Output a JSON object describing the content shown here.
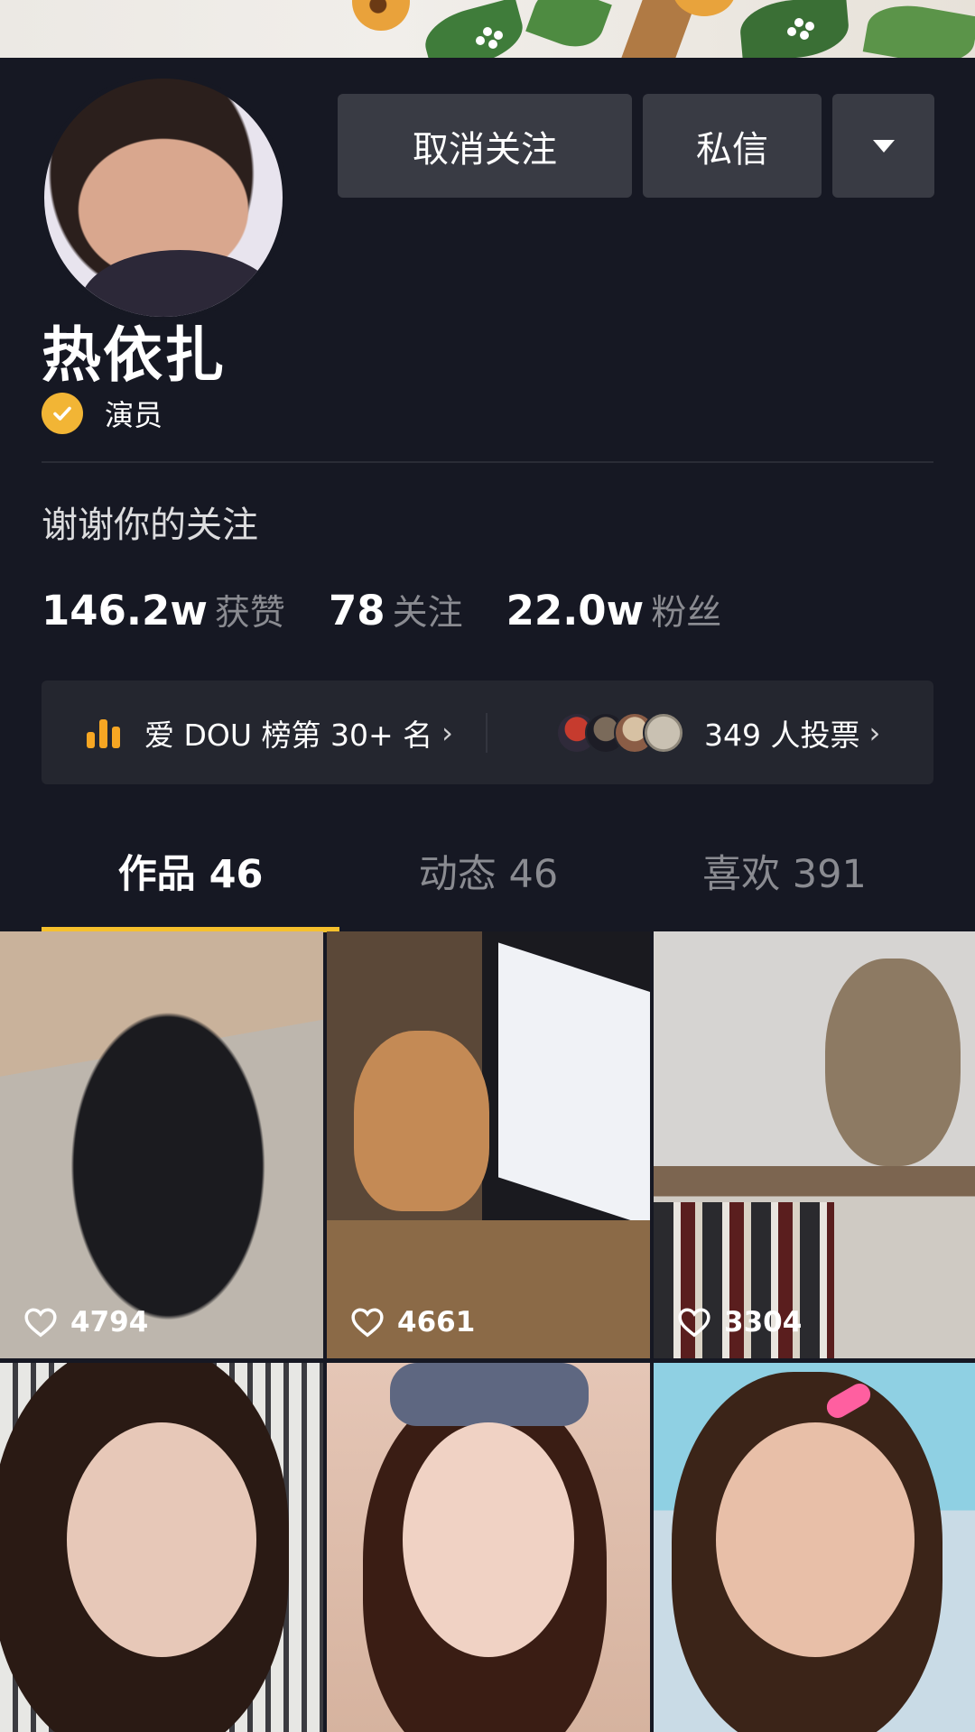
{
  "profile": {
    "name": "热依扎",
    "verified_label": "演员",
    "bio": "谢谢你的关注"
  },
  "actions": {
    "unfollow_label": "取消关注",
    "message_label": "私信",
    "more_icon": "caret-down-icon"
  },
  "stats": [
    {
      "value": "146.2w",
      "label": "获赞"
    },
    {
      "value": "78",
      "label": "关注"
    },
    {
      "value": "22.0w",
      "label": "粉丝"
    }
  ],
  "rank": {
    "icon": "bar-chart-icon",
    "label": "爱 DOU 榜第 30+ 名",
    "votes_label": "349 人投票"
  },
  "tabs": [
    {
      "label": "作品 46",
      "active": true
    },
    {
      "label": "动态 46",
      "active": false
    },
    {
      "label": "喜欢 391",
      "active": false
    }
  ],
  "videos": [
    {
      "likes": "4794"
    },
    {
      "likes": "4661"
    },
    {
      "likes": "3304"
    },
    {
      "likes": ""
    },
    {
      "likes": ""
    },
    {
      "likes": ""
    }
  ],
  "colors": {
    "background": "#161823",
    "button": "#393b44",
    "accent": "#f6c02c",
    "verified": "#f2b535",
    "rank_icon": "#f6a623"
  }
}
